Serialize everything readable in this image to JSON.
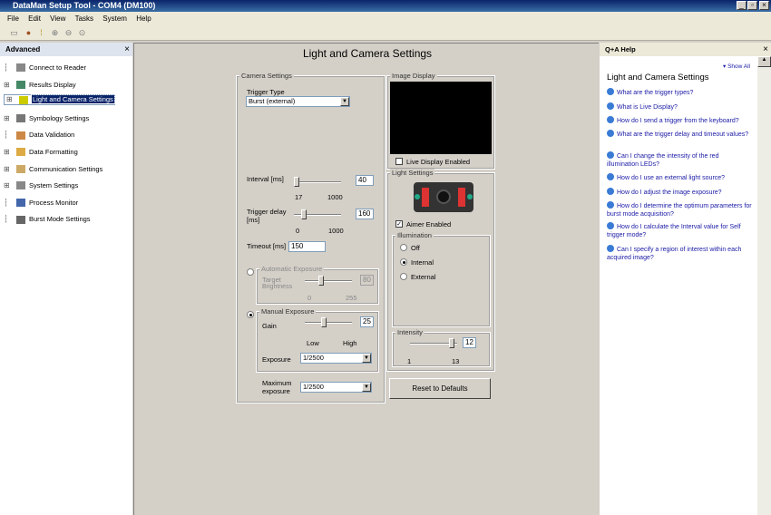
{
  "window": {
    "title": "DataMan Setup Tool - COM4 (DM100)"
  },
  "menu": [
    "File",
    "Edit",
    "View",
    "Tasks",
    "System",
    "Help"
  ],
  "left_panel": {
    "title": "Advanced",
    "items": [
      {
        "label": "Connect to Reader",
        "expandable": false
      },
      {
        "label": "Results Display",
        "expandable": true
      },
      {
        "label": "Light and Camera Settings",
        "expandable": true,
        "selected": true
      },
      {
        "label": "Symbology Settings",
        "expandable": true
      },
      {
        "label": "Data Validation",
        "expandable": false
      },
      {
        "label": "Data Formatting",
        "expandable": true
      },
      {
        "label": "Communication Settings",
        "expandable": true
      },
      {
        "label": "System Settings",
        "expandable": true
      },
      {
        "label": "Process Monitor",
        "expandable": false
      },
      {
        "label": "Burst Mode Settings",
        "expandable": false
      }
    ]
  },
  "main": {
    "title": "Light and Camera Settings",
    "camera": {
      "group": "Camera Settings",
      "trigger_type_label": "Trigger Type",
      "trigger_type": "Burst (external)",
      "interval_label": "Interval [ms]",
      "interval": "40",
      "interval_min": "17",
      "interval_max": "1000",
      "interval_pct": 0.03,
      "delay_label1": "Trigger delay",
      "delay_label2": "[ms]",
      "delay": "160",
      "delay_min": "0",
      "delay_max": "1000",
      "delay_pct": 0.16,
      "timeout_label": "Timeout [ms]",
      "timeout": "150",
      "auto_group": "Automatic Exposure",
      "target_label1": "Target",
      "target_label2": "Brightness",
      "target": "80",
      "target_min": "0",
      "target_max": "255",
      "manual_group": "Manual Exposure",
      "gain_label": "Gain",
      "gain": "25",
      "gain_low": "Low",
      "gain_high": "High",
      "exposure_label": "Exposure",
      "exposure": "1/2500",
      "max_exposure_label1": "Maximum",
      "max_exposure_label2": "exposure",
      "max_exposure": "1/2500"
    },
    "image": {
      "group": "Image Display",
      "live_label": "Live Display Enabled",
      "live": false
    },
    "light": {
      "group": "Light Settings",
      "aimer_label": "Aimer Enabled",
      "aimer": true,
      "illum_group": "Illumination",
      "options": [
        "Off",
        "Internal",
        "External"
      ],
      "selected": "Internal",
      "intensity_group": "Intensity",
      "intensity": "12",
      "intensity_min": "1",
      "intensity_max": "13"
    },
    "reset_label": "Reset to Defaults"
  },
  "help": {
    "title": "Q+A Help",
    "show_all": "▾ Show All",
    "heading": "Light and Camera Settings",
    "questions": [
      "What are the trigger types?",
      "What is Live Display?",
      "How do I send a trigger from the keyboard?",
      "What are the trigger delay and timeout values?",
      "Can I change the intensity of the red illumination LEDs?",
      "How do I use an external light source?",
      "How do I adjust the image exposure?",
      "How do I determine the optimum parameters for burst mode acquisition?",
      "How do I calculate the Interval value for Self trigger mode?",
      "Can I specify a region of interest within each acquired image?"
    ]
  }
}
